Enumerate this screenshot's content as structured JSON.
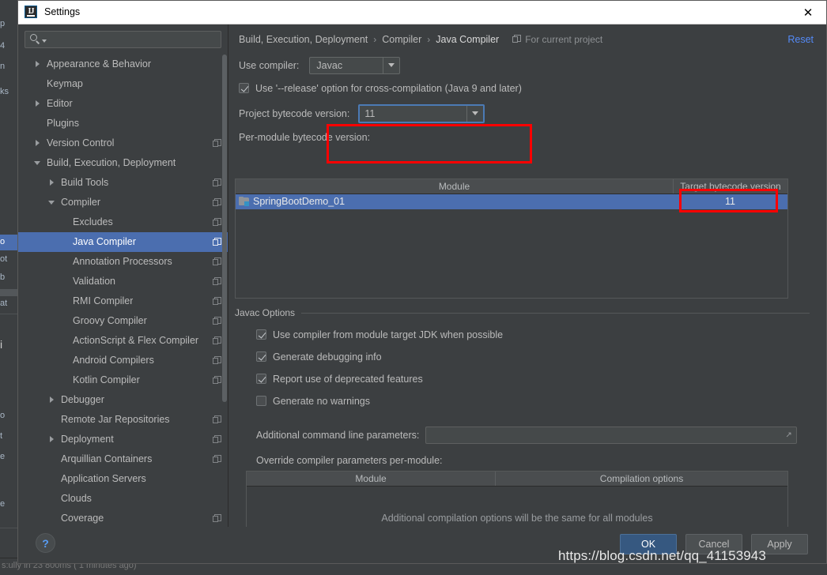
{
  "window": {
    "title": "Settings",
    "app_icon": "intellij-idea-icon",
    "close_label": "✕"
  },
  "search": {
    "value": "",
    "placeholder": ""
  },
  "sidebar": {
    "items": [
      {
        "label": "Appearance & Behavior",
        "indent": 0,
        "twisty": "right",
        "project_icon": false,
        "selected": false
      },
      {
        "label": "Keymap",
        "indent": 0,
        "twisty": "none",
        "project_icon": false,
        "selected": false
      },
      {
        "label": "Editor",
        "indent": 0,
        "twisty": "right",
        "project_icon": false,
        "selected": false
      },
      {
        "label": "Plugins",
        "indent": 0,
        "twisty": "none",
        "project_icon": false,
        "selected": false
      },
      {
        "label": "Version Control",
        "indent": 0,
        "twisty": "right",
        "project_icon": true,
        "selected": false
      },
      {
        "label": "Build, Execution, Deployment",
        "indent": 0,
        "twisty": "down",
        "project_icon": false,
        "selected": false
      },
      {
        "label": "Build Tools",
        "indent": 1,
        "twisty": "right",
        "project_icon": true,
        "selected": false
      },
      {
        "label": "Compiler",
        "indent": 1,
        "twisty": "down",
        "project_icon": true,
        "selected": false
      },
      {
        "label": "Excludes",
        "indent": 2,
        "twisty": "none",
        "project_icon": true,
        "selected": false
      },
      {
        "label": "Java Compiler",
        "indent": 2,
        "twisty": "none",
        "project_icon": true,
        "selected": true
      },
      {
        "label": "Annotation Processors",
        "indent": 2,
        "twisty": "none",
        "project_icon": true,
        "selected": false
      },
      {
        "label": "Validation",
        "indent": 2,
        "twisty": "none",
        "project_icon": true,
        "selected": false
      },
      {
        "label": "RMI Compiler",
        "indent": 2,
        "twisty": "none",
        "project_icon": true,
        "selected": false
      },
      {
        "label": "Groovy Compiler",
        "indent": 2,
        "twisty": "none",
        "project_icon": true,
        "selected": false
      },
      {
        "label": "ActionScript & Flex Compiler",
        "indent": 2,
        "twisty": "none",
        "project_icon": true,
        "selected": false
      },
      {
        "label": "Android Compilers",
        "indent": 2,
        "twisty": "none",
        "project_icon": true,
        "selected": false
      },
      {
        "label": "Kotlin Compiler",
        "indent": 2,
        "twisty": "none",
        "project_icon": true,
        "selected": false
      },
      {
        "label": "Debugger",
        "indent": 1,
        "twisty": "right",
        "project_icon": false,
        "selected": false
      },
      {
        "label": "Remote Jar Repositories",
        "indent": 1,
        "twisty": "none",
        "project_icon": true,
        "selected": false
      },
      {
        "label": "Deployment",
        "indent": 1,
        "twisty": "right",
        "project_icon": true,
        "selected": false
      },
      {
        "label": "Arquillian Containers",
        "indent": 1,
        "twisty": "none",
        "project_icon": true,
        "selected": false
      },
      {
        "label": "Application Servers",
        "indent": 1,
        "twisty": "none",
        "project_icon": false,
        "selected": false
      },
      {
        "label": "Clouds",
        "indent": 1,
        "twisty": "none",
        "project_icon": false,
        "selected": false
      },
      {
        "label": "Coverage",
        "indent": 1,
        "twisty": "none",
        "project_icon": true,
        "selected": false
      }
    ]
  },
  "breadcrumb": {
    "items": [
      "Build, Execution, Deployment",
      "Compiler",
      "Java Compiler"
    ],
    "separator": "›",
    "scope_label": "For current project",
    "reset_label": "Reset"
  },
  "compiler": {
    "use_compiler_label": "Use compiler:",
    "use_compiler_value": "Javac",
    "release_option_label": "Use '--release' option for cross-compilation (Java 9 and later)",
    "release_option_checked": true,
    "project_bytecode_label": "Project bytecode version:",
    "project_bytecode_value": "11",
    "per_module_label": "Per-module bytecode version:"
  },
  "module_table": {
    "columns": [
      "Module",
      "Target bytecode version"
    ],
    "rows": [
      {
        "module": "SpringBootDemo_01",
        "target": "11",
        "selected": true
      }
    ],
    "add_button": "+",
    "remove_button": "−"
  },
  "javac_options": {
    "group_title": "Javac Options",
    "checkboxes": [
      {
        "label": "Use compiler from module target JDK when possible",
        "checked": true
      },
      {
        "label": "Generate debugging info",
        "checked": true
      },
      {
        "label": "Report use of deprecated features",
        "checked": true
      },
      {
        "label": "Generate no warnings",
        "checked": false
      }
    ],
    "additional_params_label": "Additional command line parameters:",
    "additional_params_value": "",
    "override_label": "Override compiler parameters per-module:"
  },
  "override_table": {
    "columns": [
      "Module",
      "Compilation options"
    ],
    "empty_message": "Additional compilation options will be the same for all modules",
    "add_button": "+",
    "remove_button": "−"
  },
  "footer": {
    "help_label": "?",
    "ok_label": "OK",
    "cancel_label": "Cancel",
    "apply_label": "Apply"
  },
  "watermark": {
    "text": "https://blog.csdn.net/qq_41153943"
  },
  "background": {
    "fragments": [
      "p",
      "4",
      "n",
      "ks",
      "o",
      "ot",
      "b",
      "at",
      "i",
      "o",
      "t",
      "e",
      "e",
      "s"
    ],
    "status_text": "s:ully in 23 800ms ( 1 minutes ago)",
    "status_right": ""
  },
  "colors": {
    "accent_selection": "#4b6eaf",
    "link": "#548af7",
    "annotation_red": "#fe0000",
    "add_green": "#59a869",
    "remove_red": "#c75450",
    "panel_bg": "#3c3f41"
  }
}
